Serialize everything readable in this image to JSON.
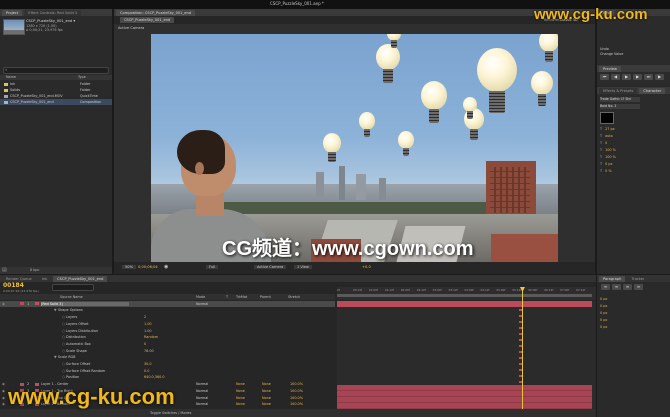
{
  "app": {
    "title": "CSCP_PuzzleSky_001.aep *"
  },
  "project_panel": {
    "tabs": [
      "Project",
      "Effect Controls: Red Solid 3"
    ],
    "comp_name": "CSCP_PuzzleSky_001_end ▾",
    "comp_info": [
      "1280 x 720 (1.00)",
      "Δ 0;00;21, 23.976 fps"
    ],
    "search_placeholder": "",
    "columns": [
      "Name",
      "Type"
    ],
    "items": [
      {
        "name": "Ink",
        "type": "Folder",
        "color": "#d4c75a"
      },
      {
        "name": "Solids",
        "type": "Folder",
        "color": "#d4c75a"
      },
      {
        "name": "CSCP_PuzzleSky_001_end.MOV",
        "type": "QuickTime",
        "color": "#9aa8b8"
      },
      {
        "name": "CSCP_PuzzleSky_001_end",
        "type": "Composition",
        "color": "#9fb5cf"
      }
    ],
    "footer": "8 bpc"
  },
  "viewer": {
    "tabs": [
      "Composition: CSCP_PuzzleSky_001_end"
    ],
    "subtab": "CSCP_PuzzleSky_001_end",
    "renderer_label": "Renderer:",
    "renderer_value": "Classic 3D",
    "camera_label": "Active Camera",
    "controls": [
      "50%",
      "Full",
      "Active Camera",
      "1 View",
      "+0.0"
    ],
    "timecode": "0;00;06;04"
  },
  "info_panel": {
    "lines": [
      "Undo",
      "Change Value"
    ],
    "preview_tab": "Preview",
    "effects_tab": "Effects & Presets",
    "character_tab": "Character",
    "character_font": "Trade Gothic LT Std",
    "character_style": "Bold No. 2",
    "character_sizes": [
      "27 px",
      "auto",
      "0",
      "100 %",
      "100 %",
      "0 px",
      "0 %"
    ]
  },
  "timeline": {
    "tabs": [
      "Render Queue",
      "Ink",
      "CSCP_PuzzleSky_001_end"
    ],
    "timecode": "00184",
    "timecode_sub": "0;00;07;16 (23.976 fps)",
    "search_placeholder": "",
    "column_headers": [
      "Source Name",
      "Mode",
      "T",
      "TrkMat",
      "Parent",
      "Stretch"
    ],
    "layers": [
      {
        "label": "1",
        "name": "[Red Solid 3]",
        "kind": "layer",
        "mode": "Normal",
        "selected": true
      },
      {
        "label": "",
        "name": "Shape Options",
        "kind": "group"
      },
      {
        "label": "",
        "name": "Layers",
        "kind": "prop",
        "value": "2"
      },
      {
        "label": "",
        "name": "Layers Offset",
        "kind": "prop",
        "value": "1.00"
      },
      {
        "label": "",
        "name": "Layers Distribution",
        "kind": "prop",
        "value": "1.00"
      },
      {
        "label": "",
        "name": "Distribution",
        "kind": "prop",
        "value": "Random"
      },
      {
        "label": "",
        "name": "Automatic Box",
        "kind": "prop",
        "value": "0"
      },
      {
        "label": "",
        "name": "Scale Shape",
        "kind": "prop",
        "value": "76.00"
      },
      {
        "label": "",
        "name": "Scale RGB",
        "kind": "group",
        "value": ""
      },
      {
        "label": "",
        "name": "Surface Offset",
        "kind": "prop",
        "value": "30.0"
      },
      {
        "label": "",
        "name": "Surface Offset Random",
        "kind": "prop",
        "value": "0.0"
      },
      {
        "label": "",
        "name": "Position",
        "kind": "prop",
        "value": "640.0,360.0"
      },
      {
        "label": "2",
        "name": "Layer 1 - Center",
        "kind": "layer",
        "mode": "Normal",
        "trk": "None",
        "parent": "None",
        "stretch": "100.0%"
      },
      {
        "label": "3",
        "name": "Layer 1 - Top Right",
        "kind": "layer",
        "mode": "Normal",
        "trk": "None",
        "parent": "None",
        "stretch": "100.0%"
      },
      {
        "label": "4",
        "name": "Layer 1 - Top Left",
        "kind": "layer",
        "mode": "Normal",
        "trk": "None",
        "parent": "None",
        "stretch": "100.0%"
      },
      {
        "label": "5",
        "name": "Layer 1 - Bottom",
        "kind": "layer",
        "mode": "Normal",
        "trk": "None",
        "parent": "None",
        "stretch": "100.0%"
      }
    ],
    "footer": "Toggle Switches / Modes",
    "ruler": [
      "0f",
      "00:12f",
      "01:00f",
      "01:12f",
      "02:00f",
      "02:12f",
      "03:00f",
      "03:12f",
      "04:00f",
      "04:12f",
      "05:00f",
      "05:12f",
      "06:00f",
      "06:12f",
      "07:00f",
      "07:12f"
    ]
  },
  "right_bottom": {
    "tabs": [
      "Paragraph",
      "Tracker"
    ],
    "values": [
      "0 px",
      "0 px",
      "0 px",
      "0 px",
      "0 px"
    ]
  },
  "watermarks": {
    "top": "www.cg-ku.com",
    "center": "CG频道：www.cgown.com",
    "bottom": "www.cg-ku.com"
  },
  "colors": {
    "accent_orange": "#f0b81a",
    "timeline_red": "#b94b5a",
    "timecode_yellow": "#f3c236"
  }
}
